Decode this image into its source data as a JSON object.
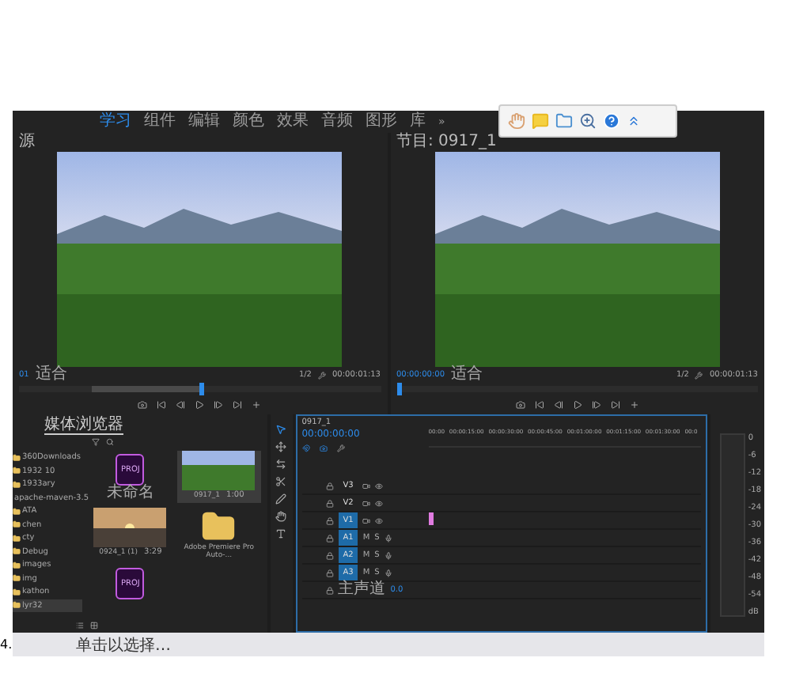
{
  "workspace_bar": {
    "tabs": [
      {
        "label": "学习",
        "selected": true
      },
      {
        "label": "组件",
        "selected": false
      },
      {
        "label": "编辑",
        "selected": false
      },
      {
        "label": "颜色",
        "selected": false
      },
      {
        "label": "效果",
        "selected": false
      },
      {
        "label": "音频",
        "selected": false
      },
      {
        "label": "图形",
        "selected": false
      },
      {
        "label": "库",
        "selected": false
      }
    ],
    "overflow": "»"
  },
  "source_monitor": {
    "title": "源",
    "timecode": "01",
    "zoom": "适合",
    "resolution": "1/2",
    "duration": "00:00:01:13",
    "level": 0.5
  },
  "program_monitor": {
    "title": "节目: 0917_1",
    "timecode": "00:00:00:00",
    "zoom": "适合",
    "resolution": "1/2",
    "duration": "00:00:01:13",
    "level": 0
  },
  "project_panel": {
    "tab": "媒体浏览器",
    "folders": [
      {
        "name": "360Downloads",
        "selected": false
      },
      {
        "name": "1932 10",
        "selected": false
      },
      {
        "name": "1933ary",
        "selected": false
      },
      {
        "name": "apache-maven-3.5",
        "selected": false
      },
      {
        "name": "ATA",
        "selected": false
      },
      {
        "name": "chen",
        "selected": false
      },
      {
        "name": "cty",
        "selected": false
      },
      {
        "name": "Debug",
        "selected": false
      },
      {
        "name": "images",
        "selected": false
      },
      {
        "name": "img",
        "selected": false
      },
      {
        "name": "kathon",
        "selected": false
      },
      {
        "name": "lyr32",
        "selected": true
      }
    ],
    "items": [
      {
        "kind": "project",
        "name": "未命名",
        "badge": "PROJ"
      },
      {
        "kind": "video",
        "name": "0917_1",
        "duration": "1:00",
        "selected": true
      },
      {
        "kind": "sunset",
        "name": "0924_1 (1)",
        "duration": "3:29",
        "selected": false
      },
      {
        "kind": "folder",
        "name": "Adobe Premiere Pro Auto-..."
      },
      {
        "kind": "project",
        "badge": "PROJ"
      }
    ]
  },
  "timeline": {
    "title": "0917_1",
    "timecode": "00:00:00:00",
    "ruler": [
      "00:00",
      "00:00:15:00",
      "00:00:30:00",
      "00:00:45:00",
      "00:01:00:00",
      "00:01:15:00",
      "00:01:30:00",
      "00:0"
    ],
    "tracks": [
      {
        "kind": "video",
        "name": "V3",
        "targeted": false
      },
      {
        "kind": "video",
        "name": "V2",
        "targeted": false
      },
      {
        "kind": "video",
        "name": "V1",
        "targeted": true
      },
      {
        "kind": "audio",
        "name": "A1",
        "targeted": true,
        "buttons": [
          "M",
          "S"
        ]
      },
      {
        "kind": "audio",
        "name": "A2",
        "targeted": true,
        "buttons": [
          "M",
          "S"
        ]
      },
      {
        "kind": "audio",
        "name": "A3",
        "targeted": true,
        "buttons": [
          "M",
          "S"
        ]
      },
      {
        "kind": "master",
        "name": "主声道",
        "value": "0.0"
      }
    ]
  },
  "meter": {
    "labels": [
      "0",
      "-6",
      "-12",
      "-18",
      "-24",
      "-30",
      "-36",
      "-42",
      "-48",
      "-54",
      "dB"
    ]
  },
  "status_bar": {
    "text": "单击以选择…"
  },
  "page_mark": "4."
}
